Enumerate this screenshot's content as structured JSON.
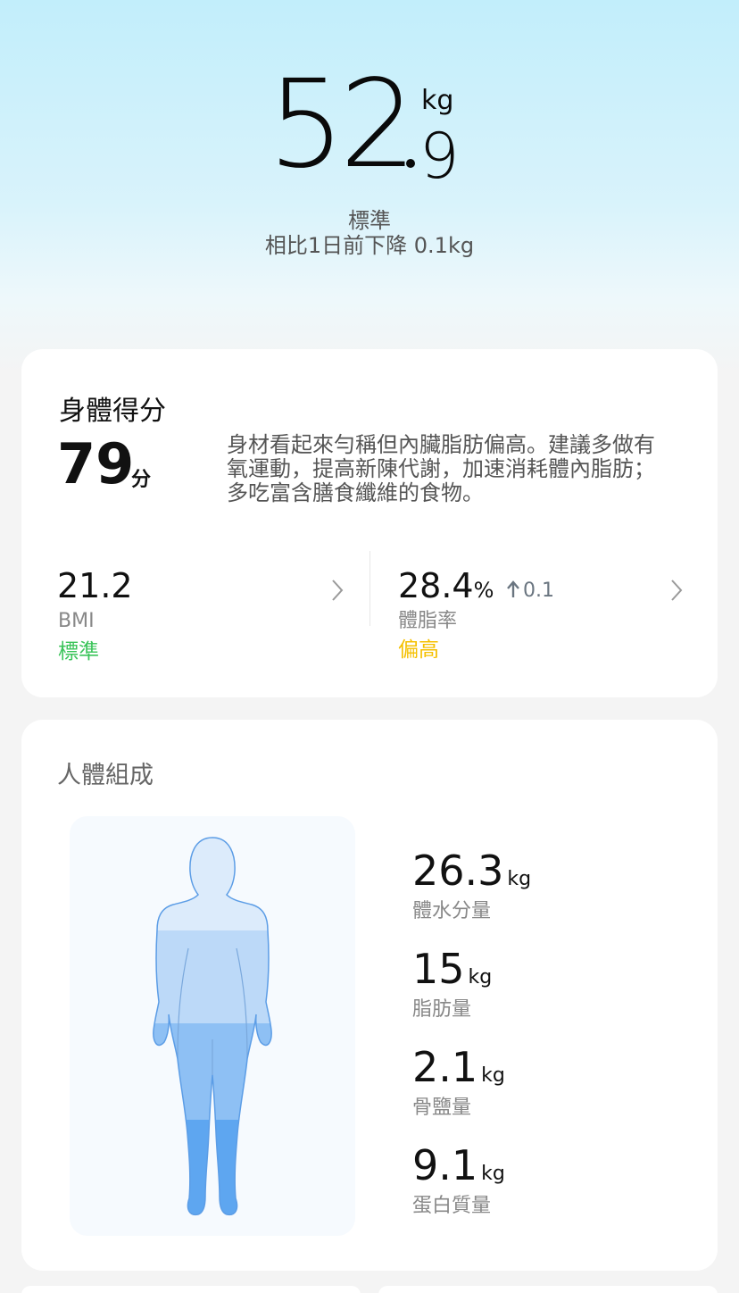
{
  "weight": {
    "integer": "52",
    "decimal": "9",
    "unit": "kg",
    "status": "標準",
    "change_text": "相比1日前下降 0.1kg"
  },
  "score_card": {
    "title": "身體得分",
    "score": "79",
    "score_unit": "分",
    "description": "身材看起來勻稱但內臟脂肪偏高。建議多做有氧運動，提高新陳代謝，加速消耗體內脂肪；多吃富含膳食纖維的食物。",
    "bmi": {
      "value": "21.2",
      "label": "BMI",
      "status": "標準",
      "status_color": "#3bc45a"
    },
    "body_fat": {
      "value": "28.4",
      "unit": "%",
      "change": "0.1",
      "label": "體脂率",
      "status": "偏高",
      "status_color": "#f5c000"
    }
  },
  "composition": {
    "title": "人體組成",
    "items": [
      {
        "value": "26.3",
        "unit": "kg",
        "label": "體水分量"
      },
      {
        "value": "15",
        "unit": "kg",
        "label": "脂肪量"
      },
      {
        "value": "2.1",
        "unit": "kg",
        "label": "骨鹽量"
      },
      {
        "value": "9.1",
        "unit": "kg",
        "label": "蛋白質量"
      }
    ]
  },
  "icons": [
    "chevron-right-icon",
    "arrow-up-icon",
    "body-figure-icon"
  ]
}
